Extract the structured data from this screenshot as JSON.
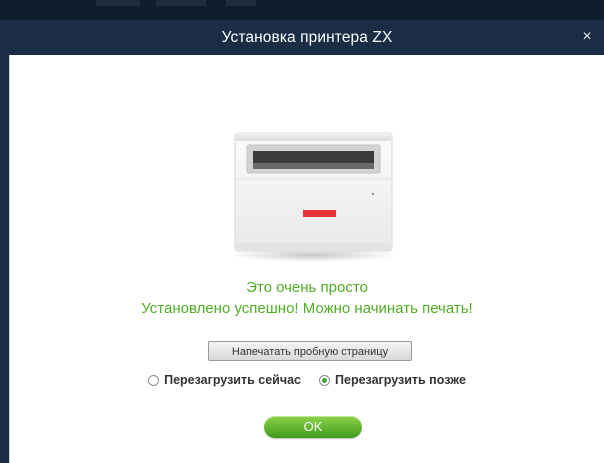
{
  "window": {
    "title": "Установка принтера ZX",
    "close_glyph": "×"
  },
  "printer_image": {
    "icon": "printer-illustration",
    "accent_color": "#e8323a"
  },
  "messages": {
    "line1": "Это очень просто",
    "line2": "Установлено успешно! Можно начинать печать!"
  },
  "actions": {
    "test_page_label": "Напечатать пробную страницу",
    "ok_label": "OK"
  },
  "restart": {
    "selected": "later",
    "options": [
      {
        "id": "now",
        "label": "Перезагрузить сейчас"
      },
      {
        "id": "later",
        "label": "Перезагрузить позже"
      }
    ]
  },
  "colors": {
    "titlebar": "#1a2d45",
    "success_text": "#4fae25",
    "ok_button": "#5bb82b"
  }
}
